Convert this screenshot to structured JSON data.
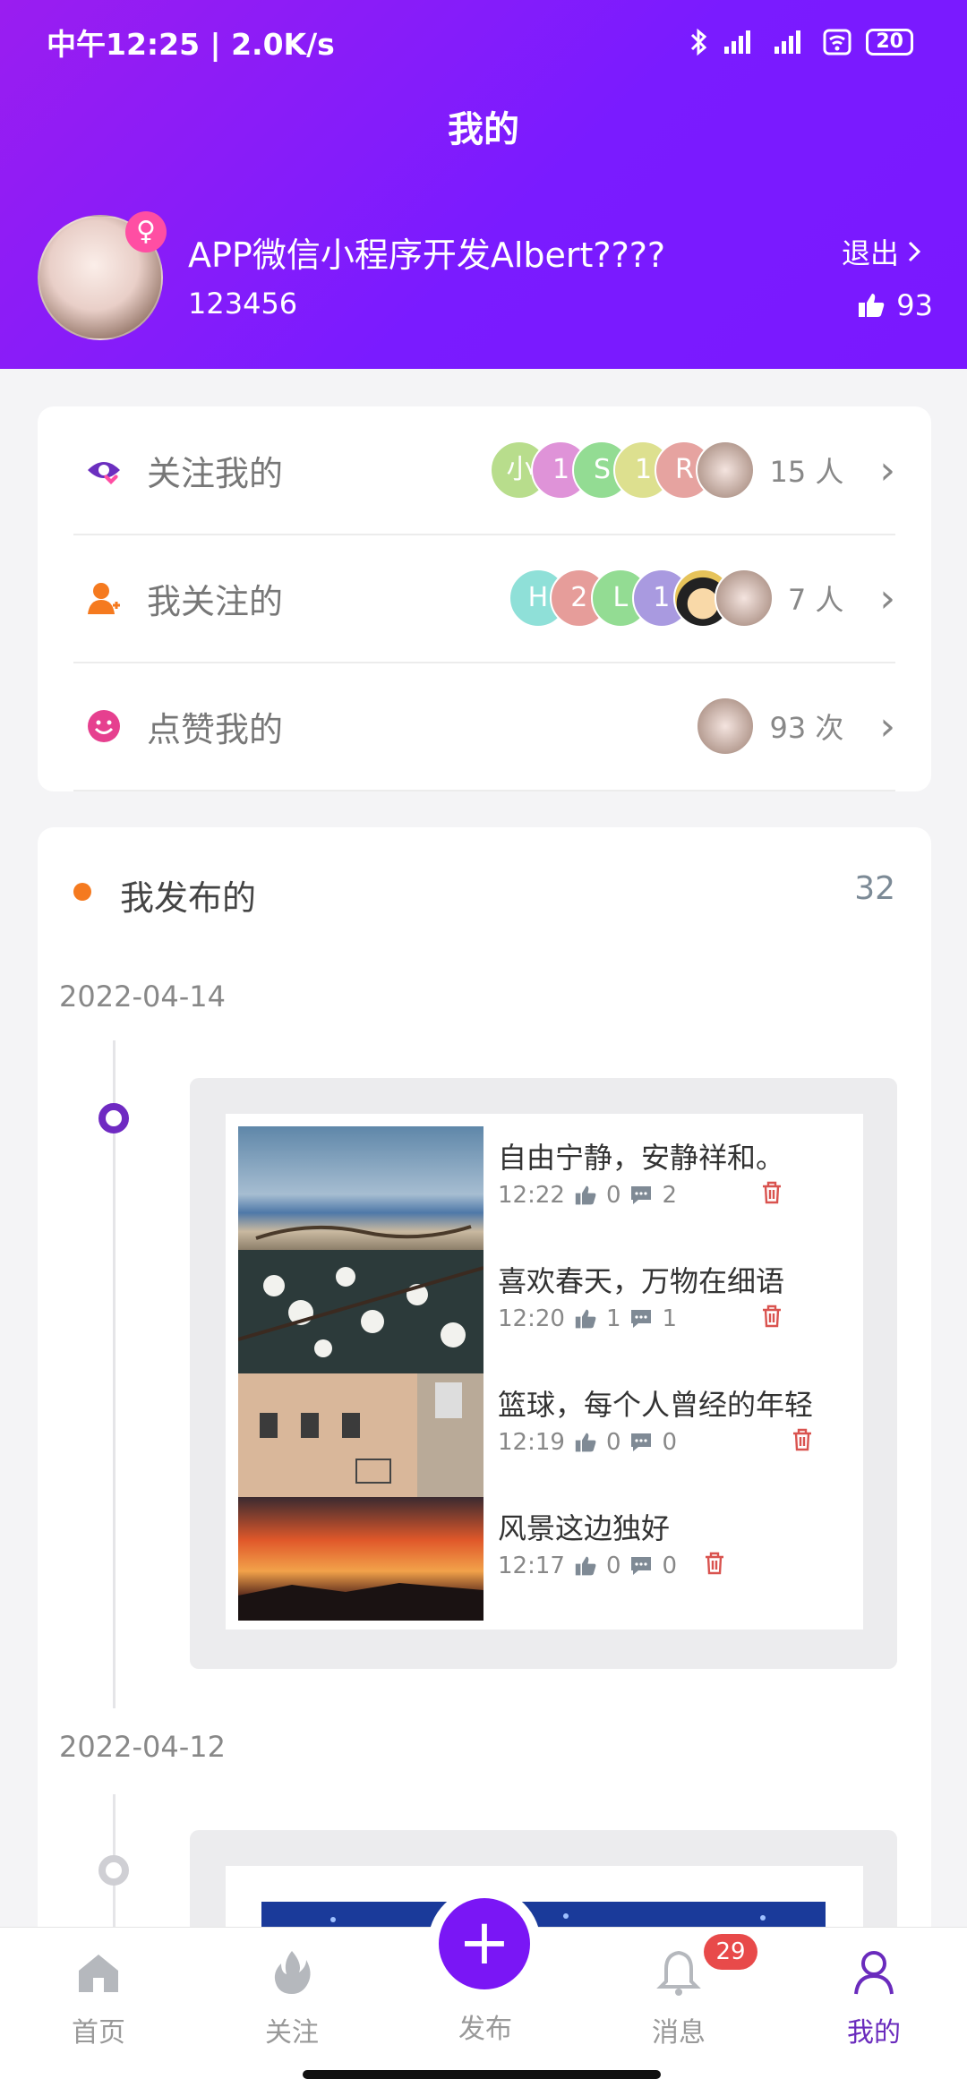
{
  "status_bar": {
    "time": "中午12:25 | 2.0K/s",
    "battery": "20"
  },
  "header": {
    "title": "我的",
    "username": "APP微信小程序开发Albert????",
    "user_id": "123456",
    "logout_label": "退出",
    "likes": "93",
    "gender_symbol": "♀"
  },
  "social_rows": [
    {
      "label": "关注我的",
      "count": "15 人",
      "avatars": [
        "小",
        "1",
        "S",
        "1",
        "R",
        ""
      ]
    },
    {
      "label": "我关注的",
      "count": "7 人",
      "avatars": [
        "H",
        "2",
        "L",
        "1",
        "",
        ""
      ]
    },
    {
      "label": "点赞我的",
      "count": "93 次",
      "avatars": [
        ""
      ]
    }
  ],
  "published": {
    "title": "我发布的",
    "count": "32",
    "groups": [
      {
        "date": "2022-04-14",
        "posts": [
          {
            "title": "自由宁静，安静祥和。",
            "time": "12:22",
            "likes": "0",
            "comments": "2"
          },
          {
            "title": "喜欢春天，万物在细语",
            "time": "12:20",
            "likes": "1",
            "comments": "1"
          },
          {
            "title": "篮球，每个人曾经的年轻",
            "time": "12:19",
            "likes": "0",
            "comments": "0"
          },
          {
            "title": "风景这边独好",
            "time": "12:17",
            "likes": "0",
            "comments": "0"
          }
        ]
      },
      {
        "date": "2022-04-12"
      }
    ]
  },
  "tabbar": {
    "home": "首页",
    "follow": "关注",
    "publish": "发布",
    "messages": "消息",
    "mine": "我的",
    "message_badge": "29"
  },
  "colors": {
    "header": "#8a1cf7",
    "accent": "#7a16f5",
    "badge": "#e84a4a"
  }
}
